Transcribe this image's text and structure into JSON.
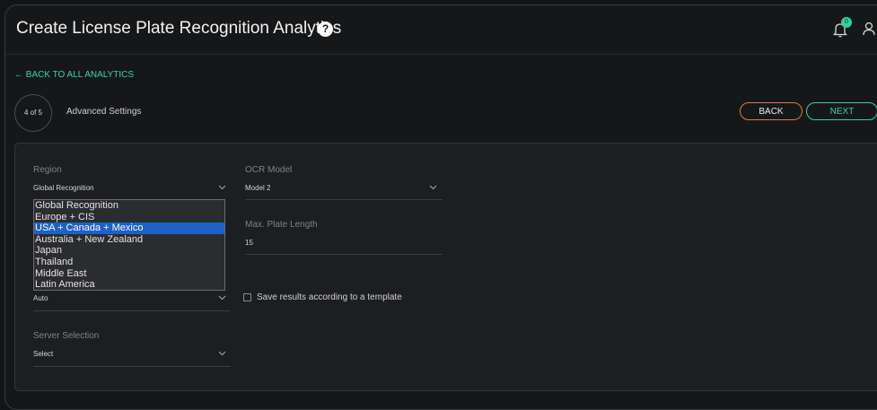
{
  "header": {
    "title": "Create License Plate Recognition Analytics",
    "help_icon": "?",
    "notification_count": "0"
  },
  "nav": {
    "back_link": "← BACK TO ALL ANALYTICS"
  },
  "stepper": {
    "step": "4 of 5",
    "label": "Advanced Settings"
  },
  "buttons": {
    "back": "BACK",
    "next": "NEXT"
  },
  "form": {
    "region": {
      "label": "Region",
      "value": "Global Recognition",
      "options": [
        "Global Recognition",
        "Europe + CIS",
        "USA + Canada + Mexico",
        "Australia + New Zealand",
        "Japan",
        "Thailand",
        "Middle East",
        "Latin America"
      ],
      "highlighted_option": "USA + Canada + Mexico"
    },
    "ocr_model": {
      "label": "OCR Model",
      "value": "Model 2"
    },
    "max_plate_length": {
      "label": "Max. Plate Length",
      "value": "15"
    },
    "hidden_select": {
      "value": "Auto"
    },
    "template_checkbox": {
      "label": "Save results according to a template",
      "checked": false
    },
    "server_selection": {
      "label": "Server Selection",
      "value": "Select"
    }
  },
  "colors": {
    "accent": "#31d6a4",
    "back_border": "#e07a3c",
    "selection": "#1c62c9"
  }
}
